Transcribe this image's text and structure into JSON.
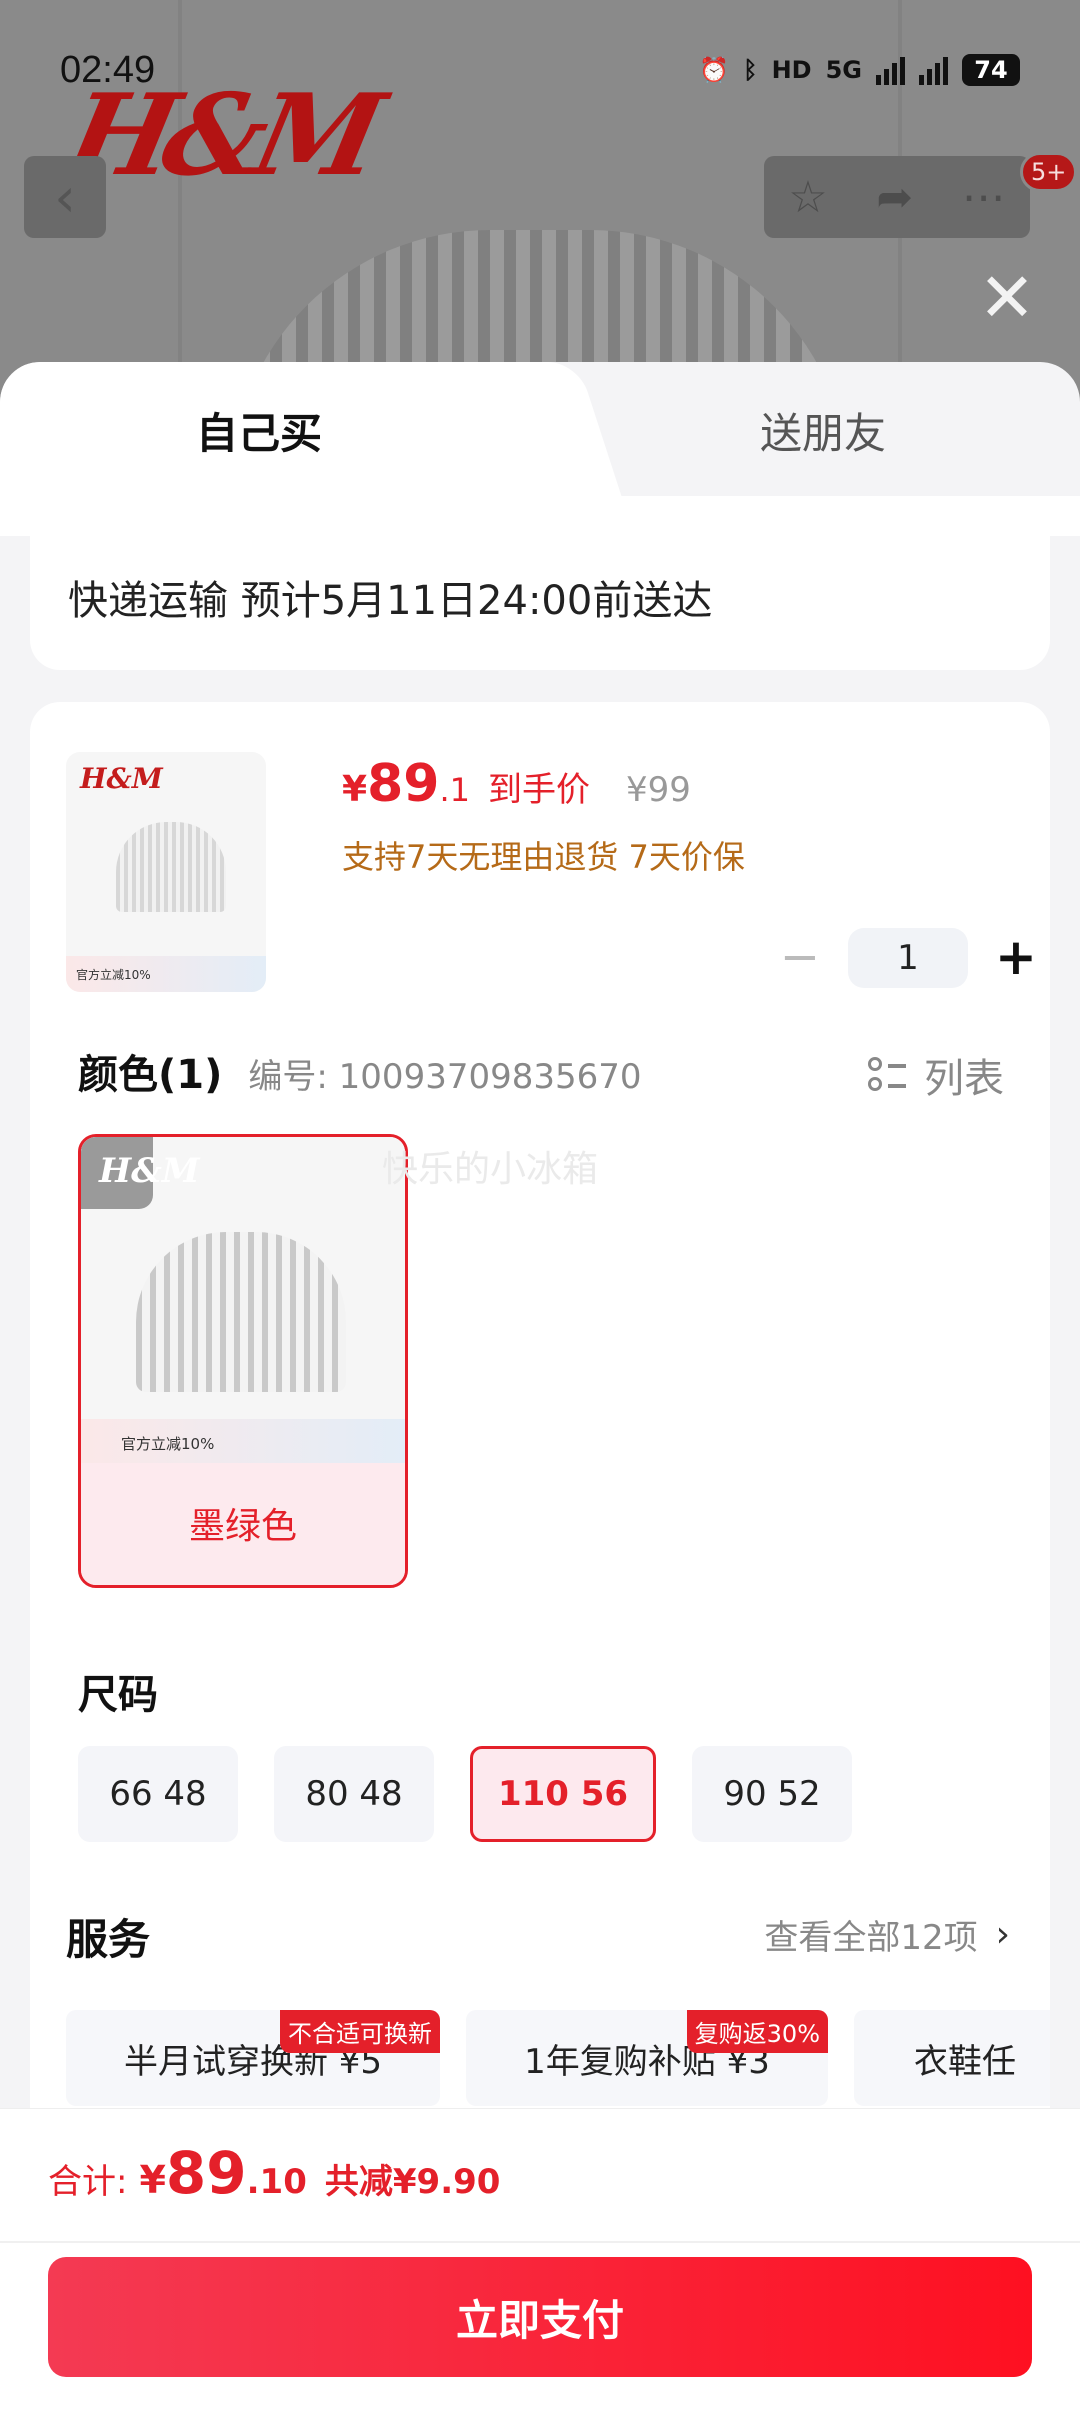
{
  "status_bar": {
    "time": "02:49",
    "hd": "HD",
    "net": "5G",
    "battery": "74"
  },
  "background": {
    "brand": "H&M",
    "badge": "5+"
  },
  "sheet": {
    "tabs": [
      {
        "label": "自己买",
        "active": true
      },
      {
        "label": "送朋友",
        "active": false
      }
    ],
    "delivery": "快递运输 预计5月11日24:00前送达",
    "product": {
      "thumb_logo": "H&M",
      "thumb_strip": "官方立减10%",
      "price_currency": "¥",
      "price_int": "89",
      "price_dec": ".1",
      "price_tag": "到手价",
      "original_price": "¥99",
      "services": "支持7天无理由退货 7天价保",
      "quantity": "1"
    },
    "color": {
      "title": "颜色(1)",
      "code": "编号: 10093709835670",
      "list_label": "列表",
      "watermark": "快乐的小冰箱",
      "option_label": "墨绿色",
      "option_strip": "官方立减10%",
      "option_logo": "H&M"
    },
    "size": {
      "title": "尺码",
      "options": [
        {
          "label": "66 48",
          "selected": false
        },
        {
          "label": "80 48",
          "selected": false
        },
        {
          "label": "110 56",
          "selected": true
        },
        {
          "label": "90 52",
          "selected": false
        }
      ]
    },
    "service": {
      "title": "服务",
      "view_all": "查看全部12项",
      "items": [
        {
          "label": "半月试穿换新 ¥5",
          "badge": "不合适可换新"
        },
        {
          "label": "1年复购补贴 ¥3",
          "badge": "复购返30%"
        },
        {
          "label": "衣鞋任",
          "badge": ""
        }
      ]
    }
  },
  "footer": {
    "total_label": "合计:",
    "total_currency": "¥",
    "total_int": "89",
    "total_dec": ".10",
    "total_save": "共减¥9.90",
    "pay_label": "立即支付"
  },
  "colors": {
    "accent": "#e4202a",
    "service_text": "#b56a18"
  }
}
